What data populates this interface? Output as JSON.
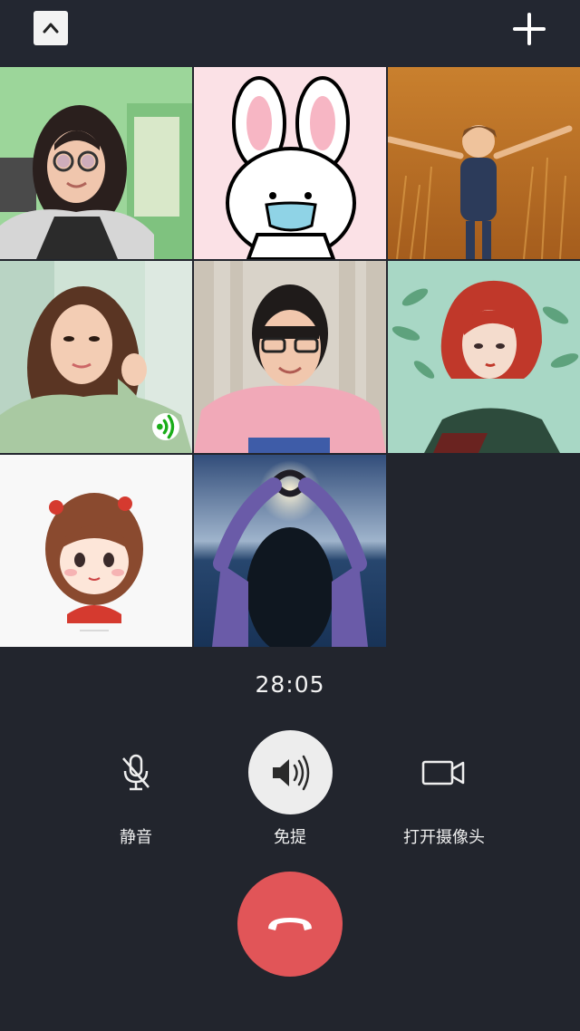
{
  "call": {
    "timer": "28:05",
    "controls": [
      {
        "label": "静音",
        "icon": "microphone-muted-icon",
        "active": false
      },
      {
        "label": "免提",
        "icon": "speaker-icon",
        "active": true
      },
      {
        "label": "打开摄像头",
        "icon": "video-camera-icon",
        "active": false
      }
    ],
    "hangup_icon": "hang-up-phone-icon"
  },
  "header": {
    "left_icon": "chevron-up-icon",
    "right_icon": "plus-icon"
  },
  "participants": [
    {
      "tile": "participant-1",
      "type": "camera-video"
    },
    {
      "tile": "participant-2",
      "type": "avatar-bunny-with-mask"
    },
    {
      "tile": "participant-3",
      "type": "avatar-child-in-wheat-field"
    },
    {
      "tile": "participant-4",
      "type": "camera-video",
      "speaking": true
    },
    {
      "tile": "participant-5",
      "type": "camera-video"
    },
    {
      "tile": "participant-6",
      "type": "avatar-red-haired-girl-illustration"
    },
    {
      "tile": "participant-7",
      "type": "avatar-cartoon-girl"
    },
    {
      "tile": "participant-8",
      "type": "avatar-heart-hands-sunset"
    }
  ],
  "colors": {
    "background": "#22252d",
    "hangup": "#e15558",
    "active_control": "#ededed",
    "speaking_indicator": "#1aad19"
  }
}
